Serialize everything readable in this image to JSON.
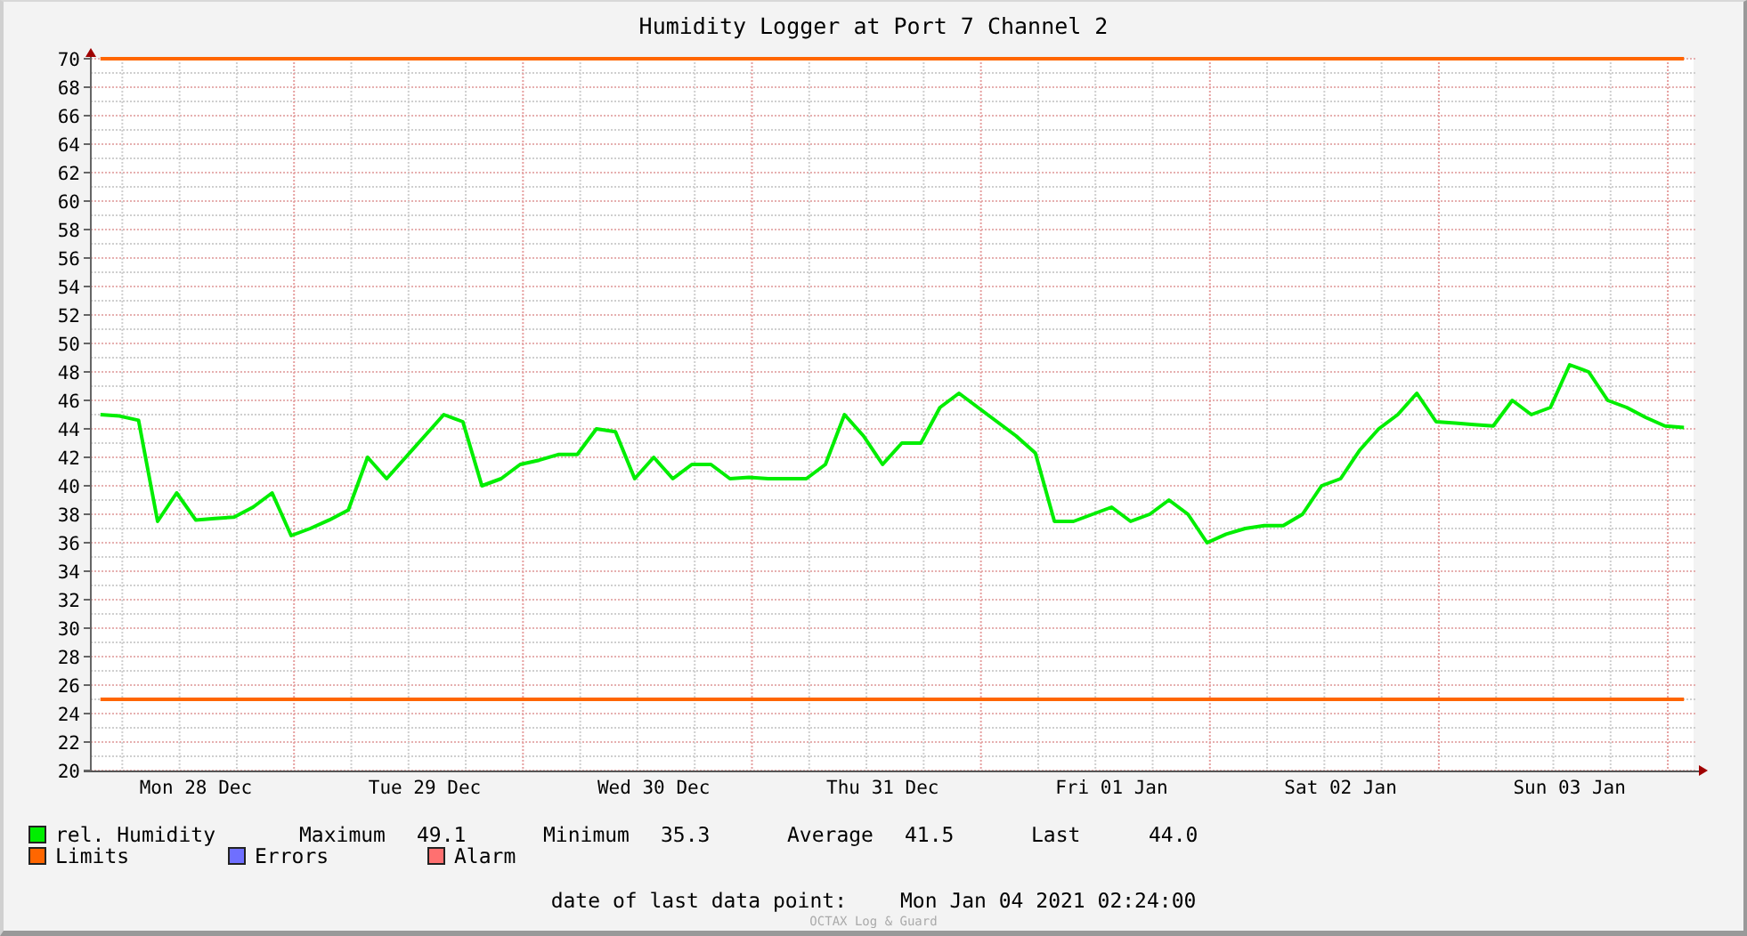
{
  "title": "Humidity Logger at Port 7 Channel 2",
  "chart_data": {
    "type": "line",
    "ylim": [
      20,
      70
    ],
    "yticks": [
      20,
      22,
      24,
      26,
      28,
      30,
      32,
      34,
      36,
      38,
      40,
      42,
      44,
      46,
      48,
      50,
      52,
      54,
      56,
      58,
      60,
      62,
      64,
      66,
      68,
      70
    ],
    "categories": [
      null,
      null,
      null,
      null,
      null,
      "Mon 28 Dec",
      null,
      null,
      null,
      null,
      null,
      null,
      null,
      null,
      null,
      null,
      null,
      "Tue 29 Dec",
      null,
      null,
      null,
      null,
      null,
      null,
      null,
      null,
      null,
      null,
      null,
      "Wed 30 Dec",
      null,
      null,
      null,
      null,
      null,
      null,
      null,
      null,
      null,
      null,
      null,
      "Thu 31 Dec",
      null,
      null,
      null,
      null,
      null,
      null,
      null,
      null,
      null,
      null,
      null,
      "Fri 01 Jan",
      null,
      null,
      null,
      null,
      null,
      null,
      null,
      null,
      null,
      null,
      null,
      "Sat 02 Jan",
      null,
      null,
      null,
      null,
      null,
      null,
      null,
      null,
      null,
      null,
      null,
      "Sun 03 Jan",
      null,
      null,
      null,
      null,
      null,
      null
    ],
    "series": [
      {
        "name": "rel. Humidity",
        "color": "#00ee00",
        "values": [
          45.0,
          44.9,
          44.6,
          37.5,
          39.5,
          37.6,
          37.7,
          37.8,
          38.5,
          39.5,
          36.5,
          37.0,
          37.6,
          38.3,
          42.0,
          40.5,
          42.0,
          43.5,
          45.0,
          44.5,
          40.0,
          40.5,
          41.5,
          41.8,
          42.2,
          42.2,
          44.0,
          43.8,
          40.5,
          42.0,
          40.5,
          41.5,
          41.5,
          40.5,
          40.6,
          40.5,
          40.5,
          40.5,
          41.5,
          45.0,
          43.5,
          41.5,
          43.0,
          43.0,
          45.5,
          46.5,
          45.5,
          44.5,
          43.5,
          42.3,
          37.5,
          37.5,
          38.0,
          38.5,
          37.5,
          38.0,
          39.0,
          38.0,
          36.0,
          36.6,
          37.0,
          37.2,
          37.2,
          38.0,
          40.0,
          40.5,
          42.5,
          44.0,
          45.0,
          46.5,
          44.5,
          44.4,
          44.3,
          44.2,
          46.0,
          45.0,
          45.5,
          48.5,
          48.0,
          46.0,
          45.5,
          44.8,
          44.2,
          44.1
        ]
      },
      {
        "name": "Limits",
        "color": "#ff6600",
        "values": [
          70,
          70,
          70,
          70,
          70,
          70,
          70,
          70,
          70,
          70,
          70,
          70,
          70,
          70,
          70,
          70,
          70,
          70,
          70,
          70,
          70,
          70,
          70,
          70,
          70,
          70,
          70,
          70,
          70,
          70,
          70,
          70,
          70,
          70,
          70,
          70,
          70,
          70,
          70,
          70,
          70,
          70,
          70,
          70,
          70,
          70,
          70,
          70,
          70,
          70,
          70,
          70,
          70,
          70,
          70,
          70,
          70,
          70,
          70,
          70,
          70,
          70,
          70,
          70,
          70,
          70,
          70,
          70,
          70,
          70,
          70,
          70,
          70,
          70,
          70,
          70,
          70,
          70,
          70,
          70,
          70,
          70,
          70,
          70
        ]
      },
      {
        "color": "#ff6600",
        "values": [
          25,
          25,
          25,
          25,
          25,
          25,
          25,
          25,
          25,
          25,
          25,
          25,
          25,
          25,
          25,
          25,
          25,
          25,
          25,
          25,
          25,
          25,
          25,
          25,
          25,
          25,
          25,
          25,
          25,
          25,
          25,
          25,
          25,
          25,
          25,
          25,
          25,
          25,
          25,
          25,
          25,
          25,
          25,
          25,
          25,
          25,
          25,
          25,
          25,
          25,
          25,
          25,
          25,
          25,
          25,
          25,
          25,
          25,
          25,
          25,
          25,
          25,
          25,
          25,
          25,
          25,
          25,
          25,
          25,
          25,
          25,
          25,
          25,
          25,
          25,
          25,
          25,
          25,
          25,
          25,
          25,
          25,
          25,
          25
        ]
      }
    ],
    "grid": true
  },
  "stats": [
    {
      "name": "Maximum",
      "value": "49.1"
    },
    {
      "name": "Minimum",
      "value": "35.3"
    },
    {
      "name": "Average",
      "value": "41.5"
    },
    {
      "name": "Last",
      "value": "44.0"
    }
  ],
  "legend": [
    {
      "label": "Errors",
      "color": "#6f6fff"
    },
    {
      "label": "Alarm",
      "color": "#ff7070"
    }
  ],
  "footer": {
    "label": "date of last data point:",
    "value": "Mon Jan 04 2021 02:24:00"
  },
  "credit": "OCTAX Log & Guard"
}
